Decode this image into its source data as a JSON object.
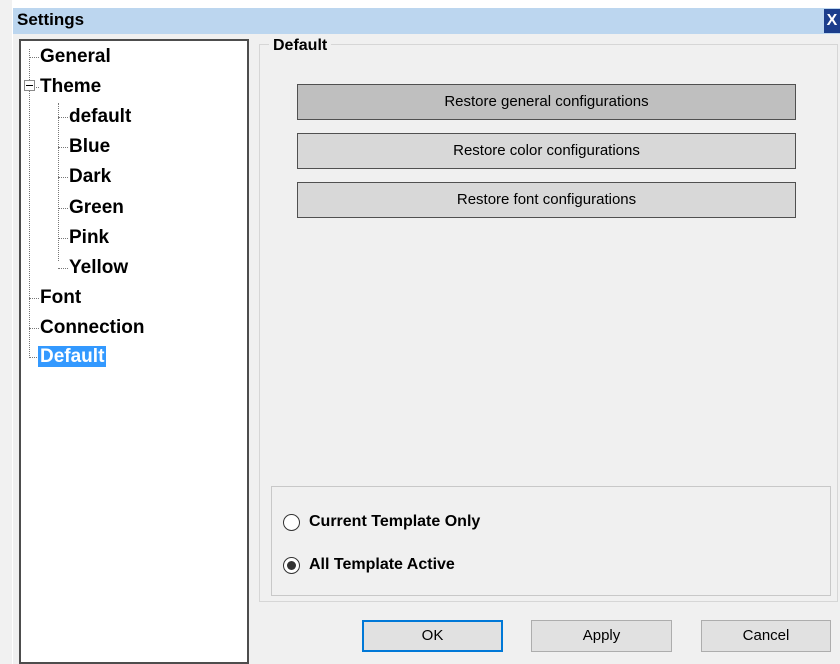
{
  "window": {
    "title": "Settings",
    "close_label": "X"
  },
  "tree": {
    "nodes": [
      {
        "label": "General"
      },
      {
        "label": "Theme"
      },
      {
        "label": "default"
      },
      {
        "label": "Blue"
      },
      {
        "label": "Dark"
      },
      {
        "label": "Green"
      },
      {
        "label": "Pink"
      },
      {
        "label": "Yellow"
      },
      {
        "label": "Font"
      },
      {
        "label": "Connection"
      },
      {
        "label": "Default"
      }
    ],
    "selected": "Default"
  },
  "panel": {
    "group_title": "Default",
    "buttons": [
      {
        "label": "Restore general configurations"
      },
      {
        "label": "Restore color configurations"
      },
      {
        "label": "Restore font configurations"
      }
    ],
    "radios": [
      {
        "label": "Current Template Only",
        "checked": false
      },
      {
        "label": "All Template Active",
        "checked": true
      }
    ]
  },
  "footer": {
    "ok_label": "OK",
    "apply_label": "Apply",
    "cancel_label": "Cancel"
  },
  "icons": {
    "expander": "collapse-minus-icon",
    "close": "close-icon"
  },
  "colors": {
    "titlebar": "#bcd6ef",
    "close_button": "#1c3e8c",
    "selection": "#3399ff",
    "default_button_border": "#0078d7"
  }
}
